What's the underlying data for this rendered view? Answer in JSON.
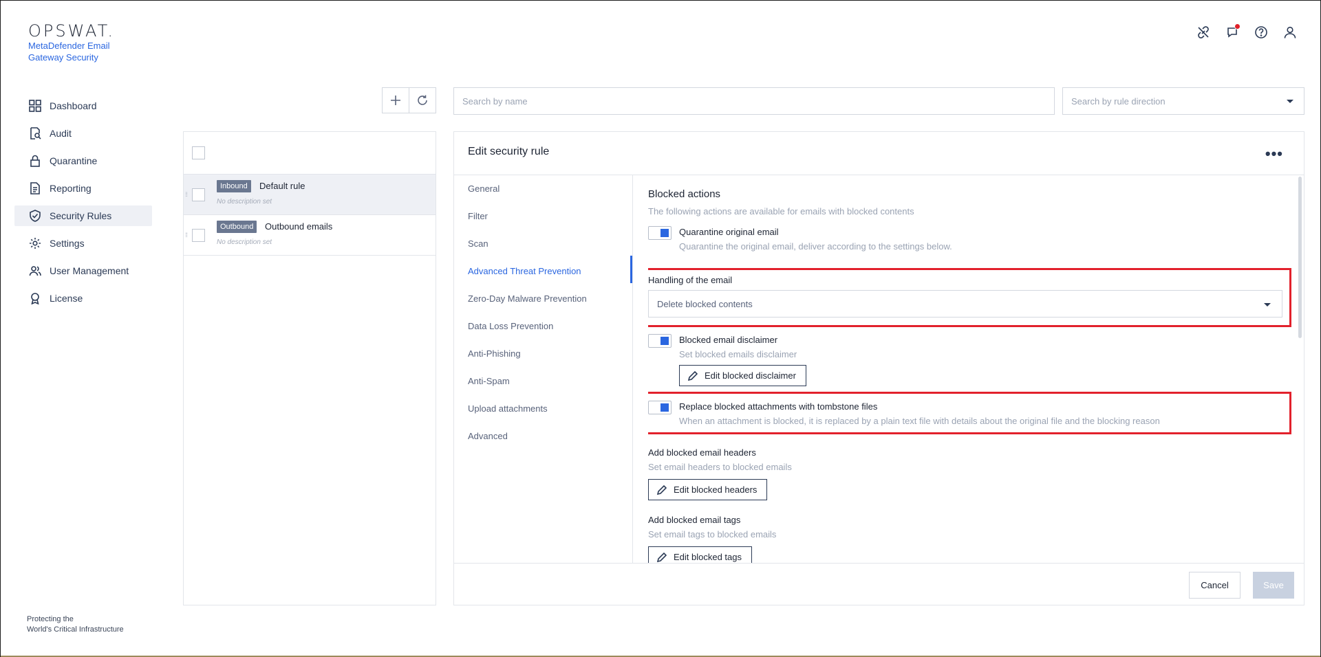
{
  "brand": {
    "logo_text": "OPSWAT.",
    "product_name": "MetaDefender Email Gateway Security",
    "tagline_line1": "Protecting the",
    "tagline_line2": "World's Critical Infrastructure"
  },
  "sidebar": {
    "items": [
      {
        "label": "Dashboard",
        "icon": "grid-icon"
      },
      {
        "label": "Audit",
        "icon": "audit-icon"
      },
      {
        "label": "Quarantine",
        "icon": "lock-icon"
      },
      {
        "label": "Reporting",
        "icon": "document-icon"
      },
      {
        "label": "Security Rules",
        "icon": "shield-check-icon",
        "active": true
      },
      {
        "label": "Settings",
        "icon": "gear-icon"
      },
      {
        "label": "User Management",
        "icon": "users-icon"
      },
      {
        "label": "License",
        "icon": "badge-icon"
      }
    ]
  },
  "search": {
    "name_placeholder": "Search by name",
    "direction_placeholder": "Search by rule direction"
  },
  "rules": [
    {
      "badge": "Inbound",
      "name": "Default rule",
      "description": "No description set",
      "selected": true
    },
    {
      "badge": "Outbound",
      "name": "Outbound emails",
      "description": "No description set",
      "selected": false
    }
  ],
  "edit": {
    "title": "Edit security rule",
    "more": "•••",
    "tabs": [
      "General",
      "Filter",
      "Scan",
      "Advanced Threat Prevention",
      "Zero-Day Malware Prevention",
      "Data Loss Prevention",
      "Anti-Phishing",
      "Anti-Spam",
      "Upload attachments",
      "Advanced"
    ],
    "active_tab": "Advanced Threat Prevention",
    "section_title": "Blocked actions",
    "section_desc": "The following actions are available for emails with blocked contents",
    "quarantine_label": "Quarantine original email",
    "quarantine_desc": "Quarantine the original email, deliver according to the settings below.",
    "handling_label": "Handling of the email",
    "handling_value": "Delete blocked contents",
    "disclaimer_label": "Blocked email disclaimer",
    "disclaimer_desc": "Set blocked emails disclaimer",
    "disclaimer_button": "Edit blocked disclaimer",
    "tombstone_label": "Replace blocked attachments with tombstone files",
    "tombstone_desc": "When an attachment is blocked, it is replaced by a plain text file with details about the original file and the blocking reason",
    "headers_label": "Add blocked email headers",
    "headers_desc": "Set email headers to blocked emails",
    "headers_button": "Edit blocked headers",
    "tags_label": "Add blocked email tags",
    "tags_desc": "Set email tags to blocked emails",
    "tags_button": "Edit blocked tags",
    "cancel": "Cancel",
    "save": "Save"
  },
  "colors": {
    "accent": "#2a66e0",
    "highlight": "#e2212c",
    "badge": "#6a7790"
  }
}
